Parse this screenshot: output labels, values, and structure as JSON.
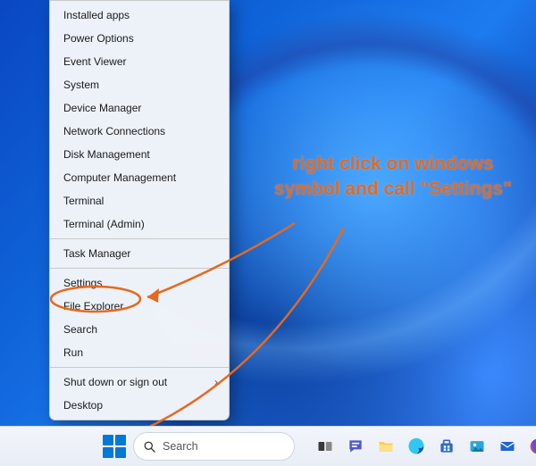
{
  "context_menu": {
    "items": [
      {
        "label": "Installed apps"
      },
      {
        "label": "Power Options"
      },
      {
        "label": "Event Viewer"
      },
      {
        "label": "System"
      },
      {
        "label": "Device Manager"
      },
      {
        "label": "Network Connections"
      },
      {
        "label": "Disk Management"
      },
      {
        "label": "Computer Management"
      },
      {
        "label": "Terminal"
      },
      {
        "label": "Terminal (Admin)"
      },
      {
        "sep": true
      },
      {
        "label": "Task Manager"
      },
      {
        "sep": true
      },
      {
        "label": "Settings",
        "highlighted": true
      },
      {
        "label": "File Explorer"
      },
      {
        "label": "Search"
      },
      {
        "label": "Run"
      },
      {
        "sep": true
      },
      {
        "label": "Shut down or sign out",
        "submenu": true
      },
      {
        "label": "Desktop"
      }
    ]
  },
  "annotation": {
    "text": "right click on windows symbol and call \"Settings\"",
    "color": "#e46a1f"
  },
  "taskbar": {
    "search_label": "Search",
    "icons": [
      {
        "name": "start",
        "semantic": "windows-start-icon"
      },
      {
        "name": "search",
        "semantic": "search-icon"
      },
      {
        "name": "taskview",
        "semantic": "task-view-icon"
      },
      {
        "name": "chat",
        "semantic": "chat-icon"
      },
      {
        "name": "explorer",
        "semantic": "file-explorer-icon"
      },
      {
        "name": "edge",
        "semantic": "edge-browser-icon"
      },
      {
        "name": "store",
        "semantic": "microsoft-store-icon"
      },
      {
        "name": "photos",
        "semantic": "photos-icon"
      },
      {
        "name": "mail",
        "semantic": "mail-icon"
      },
      {
        "name": "firefox",
        "semantic": "firefox-icon"
      }
    ]
  }
}
